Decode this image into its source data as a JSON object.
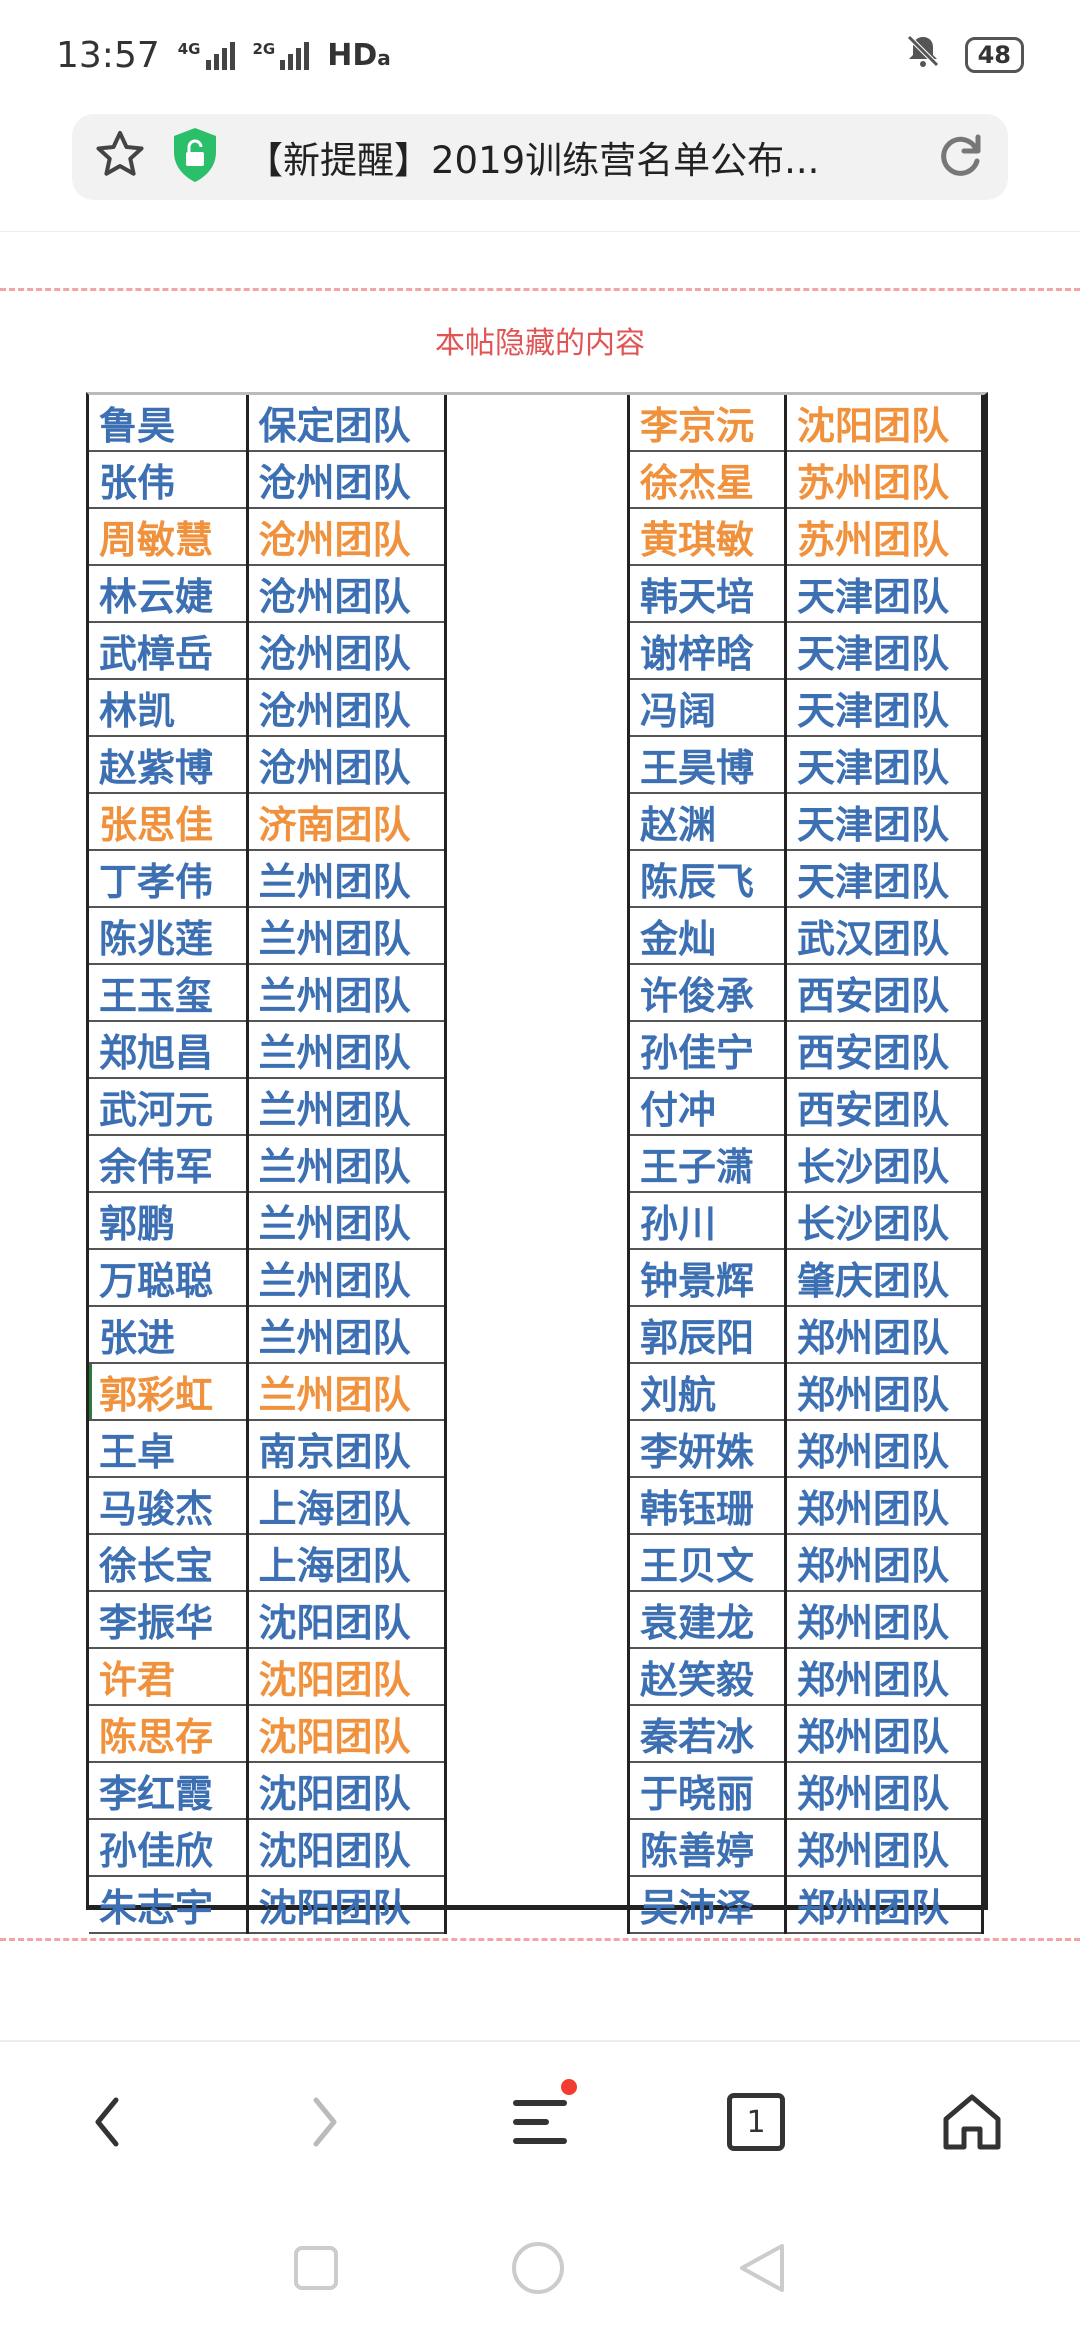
{
  "status_bar": {
    "time": "13:57",
    "sig1": "4G",
    "sig2": "2G",
    "hd": "HD",
    "battery": "48"
  },
  "address_bar": {
    "title": "【新提醒】2019训练营名单公布..."
  },
  "hidden_content_label": "本帖隐藏的内容",
  "roster_left": [
    {
      "name": "鲁昊",
      "team": "保定团队",
      "hl": false
    },
    {
      "name": "张伟",
      "team": "沧州团队",
      "hl": false
    },
    {
      "name": "周敏慧",
      "team": "沧州团队",
      "hl": true
    },
    {
      "name": "林云婕",
      "team": "沧州团队",
      "hl": false
    },
    {
      "name": "武樟岳",
      "team": "沧州团队",
      "hl": false
    },
    {
      "name": "林凯",
      "team": "沧州团队",
      "hl": false
    },
    {
      "name": "赵紫博",
      "team": "沧州团队",
      "hl": false
    },
    {
      "name": "张思佳",
      "team": "济南团队",
      "hl": true
    },
    {
      "name": "丁孝伟",
      "team": "兰州团队",
      "hl": false
    },
    {
      "name": "陈兆莲",
      "team": "兰州团队",
      "hl": false
    },
    {
      "name": "王玉玺",
      "team": "兰州团队",
      "hl": false
    },
    {
      "name": "郑旭昌",
      "team": "兰州团队",
      "hl": false
    },
    {
      "name": "武河元",
      "team": "兰州团队",
      "hl": false
    },
    {
      "name": "余伟军",
      "team": "兰州团队",
      "hl": false
    },
    {
      "name": "郭鹏",
      "team": "兰州团队",
      "hl": false
    },
    {
      "name": "万聪聪",
      "team": "兰州团队",
      "hl": false
    },
    {
      "name": "张进",
      "team": "兰州团队",
      "hl": false
    },
    {
      "name": "郭彩虹",
      "team": "兰州团队",
      "hl": true
    },
    {
      "name": "王卓",
      "team": "南京团队",
      "hl": false
    },
    {
      "name": "马骏杰",
      "team": "上海团队",
      "hl": false
    },
    {
      "name": "徐长宝",
      "team": "上海团队",
      "hl": false
    },
    {
      "name": "李振华",
      "team": "沈阳团队",
      "hl": false
    },
    {
      "name": "许君",
      "team": "沈阳团队",
      "hl": true
    },
    {
      "name": "陈思存",
      "team": "沈阳团队",
      "hl": true
    },
    {
      "name": "李红霞",
      "team": "沈阳团队",
      "hl": false
    },
    {
      "name": "孙佳欣",
      "team": "沈阳团队",
      "hl": false
    },
    {
      "name": "朱志宇",
      "team": "沈阳团队",
      "hl": false
    }
  ],
  "roster_right": [
    {
      "name": "李京沅",
      "team": "沈阳团队",
      "hl": true
    },
    {
      "name": "徐杰星",
      "team": "苏州团队",
      "hl": true
    },
    {
      "name": "黄琪敏",
      "team": "苏州团队",
      "hl": true
    },
    {
      "name": "韩天培",
      "team": "天津团队",
      "hl": false
    },
    {
      "name": "谢梓晗",
      "team": "天津团队",
      "hl": false
    },
    {
      "name": "冯阔",
      "team": "天津团队",
      "hl": false
    },
    {
      "name": "王昊博",
      "team": "天津团队",
      "hl": false
    },
    {
      "name": "赵渊",
      "team": "天津团队",
      "hl": false
    },
    {
      "name": "陈辰飞",
      "team": "天津团队",
      "hl": false
    },
    {
      "name": "金灿",
      "team": "武汉团队",
      "hl": false
    },
    {
      "name": "许俊承",
      "team": "西安团队",
      "hl": false
    },
    {
      "name": "孙佳宁",
      "team": "西安团队",
      "hl": false
    },
    {
      "name": "付冲",
      "team": "西安团队",
      "hl": false
    },
    {
      "name": "王子潇",
      "team": "长沙团队",
      "hl": false
    },
    {
      "name": "孙川",
      "team": "长沙团队",
      "hl": false
    },
    {
      "name": "钟景辉",
      "team": "肇庆团队",
      "hl": false
    },
    {
      "name": "郭辰阳",
      "team": "郑州团队",
      "hl": false
    },
    {
      "name": "刘航",
      "team": "郑州团队",
      "hl": false
    },
    {
      "name": "李妍姝",
      "team": "郑州团队",
      "hl": false
    },
    {
      "name": "韩钰珊",
      "team": "郑州团队",
      "hl": false
    },
    {
      "name": "王贝文",
      "team": "郑州团队",
      "hl": false
    },
    {
      "name": "袁建龙",
      "team": "郑州团队",
      "hl": false
    },
    {
      "name": "赵笑毅",
      "team": "郑州团队",
      "hl": false
    },
    {
      "name": "秦若冰",
      "team": "郑州团队",
      "hl": false
    },
    {
      "name": "于晓丽",
      "team": "郑州团队",
      "hl": false
    },
    {
      "name": "陈善婷",
      "team": "郑州团队",
      "hl": false
    },
    {
      "name": "吴沛泽",
      "team": "郑州团队",
      "hl": false
    }
  ],
  "bottom_nav": {
    "tab_count": "1"
  },
  "colors": {
    "name_blue": "#3d6fb3",
    "name_orange": "#f0923d",
    "hidden_label_red": "#e25454",
    "badge_red": "#f33b2f"
  }
}
